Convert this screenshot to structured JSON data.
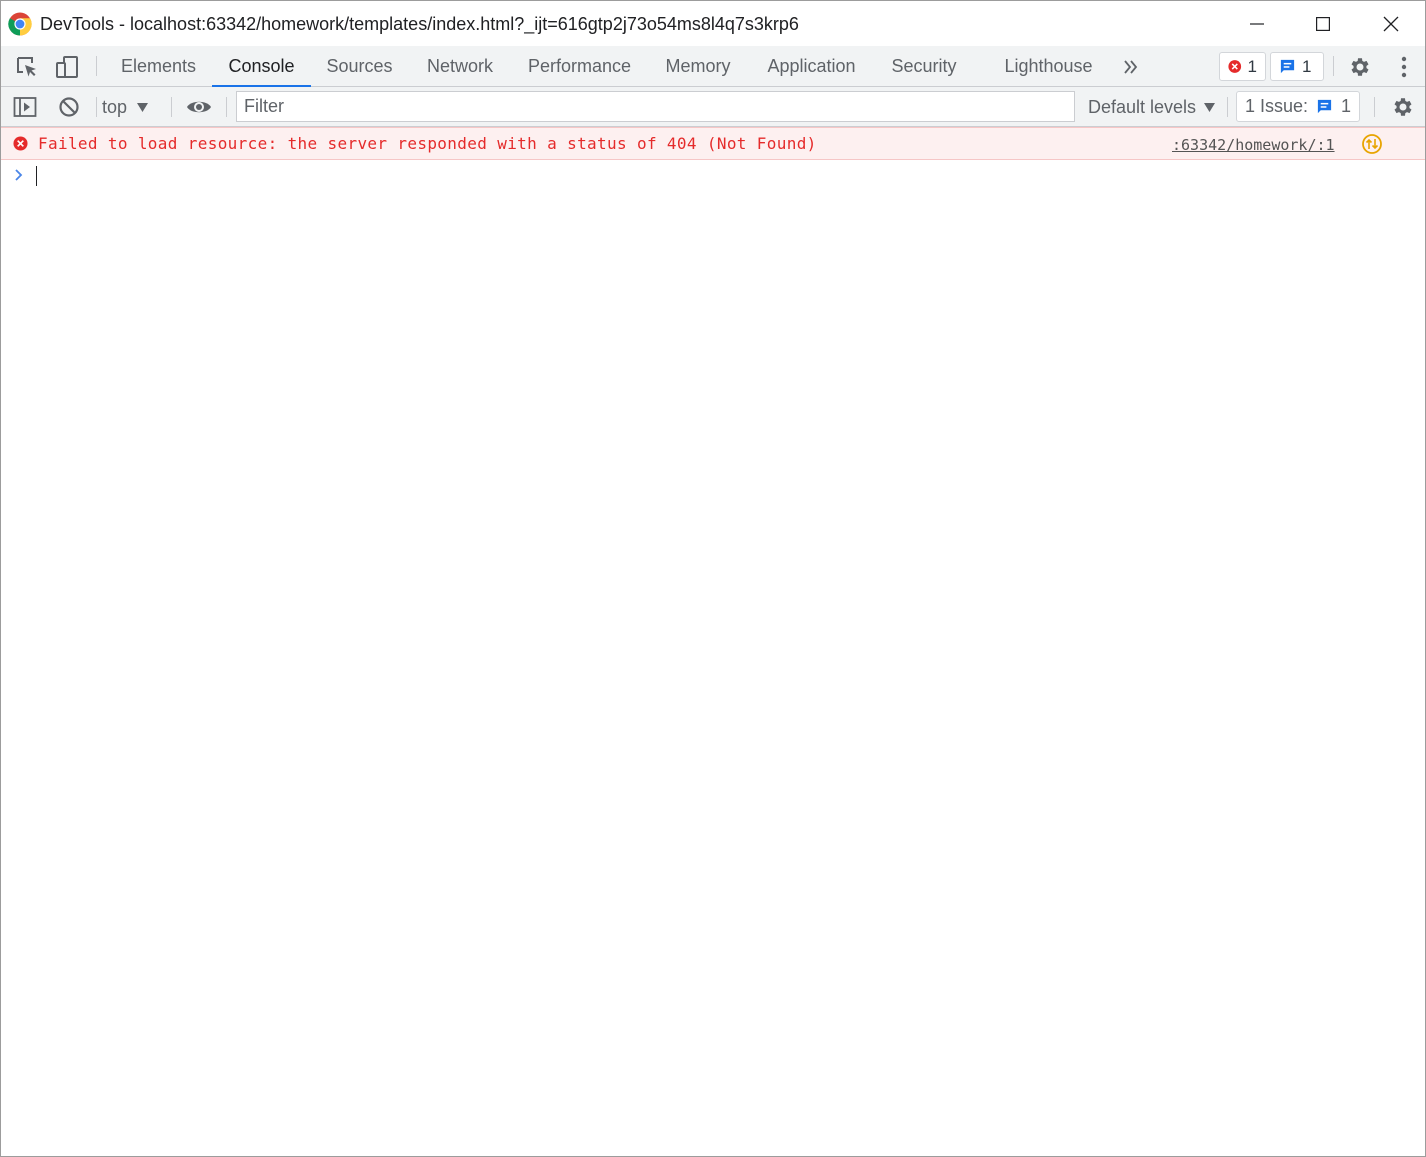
{
  "window": {
    "title": "DevTools - localhost:63342/homework/templates/index.html?_ijt=616gtp2j73o54ms8l4q7s3krp6",
    "controls": [
      "minimize",
      "maximize",
      "close"
    ]
  },
  "tabbar": {
    "tabs": [
      {
        "label": "Elements",
        "active": false
      },
      {
        "label": "Console",
        "active": true
      },
      {
        "label": "Sources",
        "active": false
      },
      {
        "label": "Network",
        "active": false
      },
      {
        "label": "Performance",
        "active": false
      },
      {
        "label": "Memory",
        "active": false
      },
      {
        "label": "Application",
        "active": false
      },
      {
        "label": "Security",
        "active": false
      },
      {
        "label": "Lighthouse",
        "active": false
      }
    ],
    "error_count": "1",
    "message_count": "1"
  },
  "toolbar": {
    "context": "top",
    "filter_placeholder": "Filter",
    "filter_value": "",
    "levels": "Default levels",
    "issues_label": "1 Issue:",
    "issues_count": "1"
  },
  "console": {
    "messages": [
      {
        "level": "error",
        "text": "Failed to load resource: the server responded with a status of 404 (Not Found)",
        "source": ":63342/homework/:1"
      }
    ]
  },
  "colors": {
    "accent": "#1a73e8",
    "error": "#e52b2b",
    "error_bg": "#fdf0f0",
    "toolbar_bg": "#f1f3f4"
  },
  "icons": [
    "chrome-logo-icon",
    "minimize-icon",
    "maximize-icon",
    "close-icon",
    "inspect-element-icon",
    "device-toolbar-icon",
    "more-tabs-icon",
    "error-icon",
    "message-icon",
    "settings-icon",
    "more-options-icon",
    "sidebar-toggle-icon",
    "clear-console-icon",
    "dropdown-arrow-icon",
    "eye-icon",
    "chevron-right-icon",
    "network-request-icon"
  ]
}
